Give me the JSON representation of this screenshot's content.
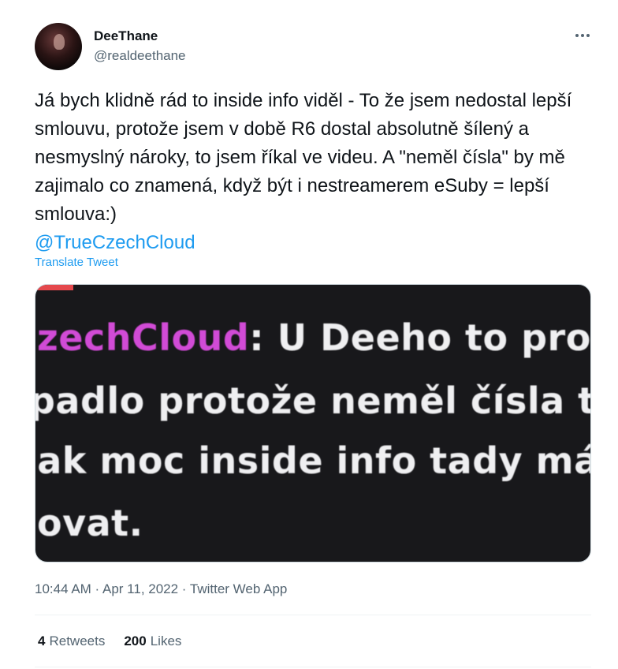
{
  "author": {
    "display_name": "DeeThane",
    "handle": "@realdeethane"
  },
  "tweet": {
    "text": "Já bych klidně rád to inside info viděl - To že jsem nedostal lepší smlouvu, protože jsem v době R6 dostal absolutně šílený a nesmyslný nároky, to jsem říkal ve videu. A \"neměl čísla\" by mě zajimalo co znamená, když být i nestreamerem eSuby = lepší smlouva:)",
    "mention": "@TrueCzechCloud",
    "translate_label": "Translate Tweet",
    "timestamp": "10:44 AM · Apr 11, 2022 · Twitter Web App"
  },
  "media": {
    "chat_name": "zechCloud",
    "line1_rest": ": U Deeho to prostě",
    "line2": "padlo protože neměl čísla to je",
    "line3": "jak moc inside info tady mám",
    "line4": "ovat."
  },
  "stats": {
    "retweets_count": "4",
    "retweets_label": "Retweets",
    "likes_count": "200",
    "likes_label": "Likes"
  },
  "icons": {
    "more": "more-horizontal-icon"
  },
  "colors": {
    "accent": "#1d9bf0",
    "secondary_text": "#536471",
    "media_background": "#18181b",
    "chat_name": "#d14bd6"
  }
}
